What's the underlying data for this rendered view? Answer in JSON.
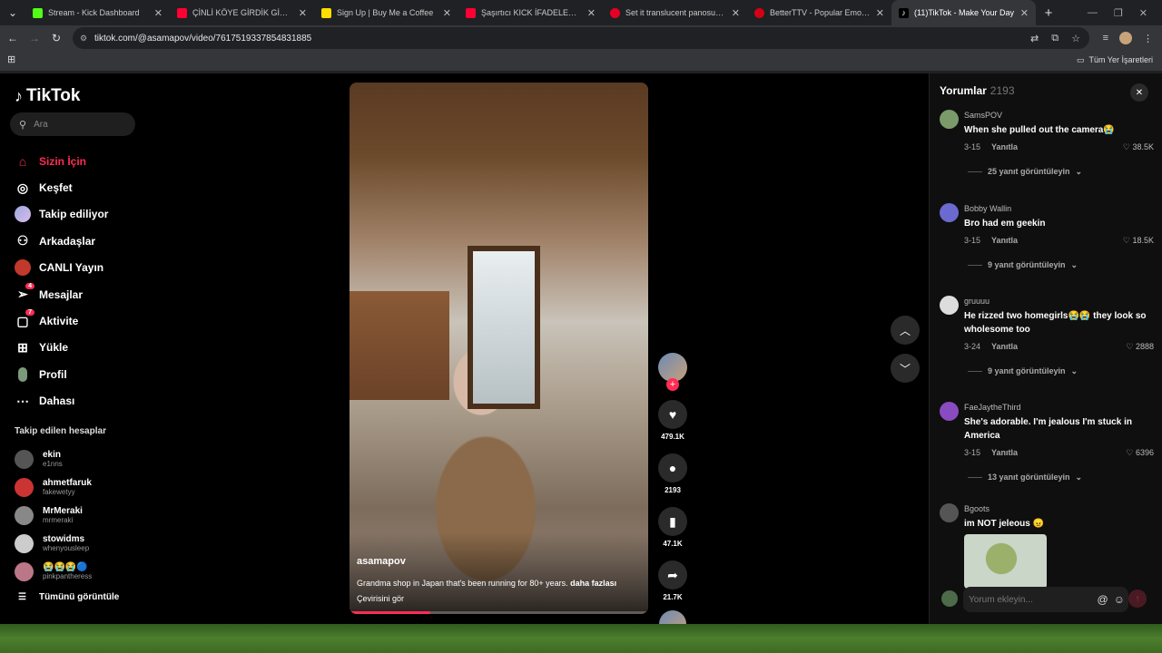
{
  "browser": {
    "tabs": [
      {
        "title": "Stream - Kick Dashboard",
        "color": "#53fc18"
      },
      {
        "title": "ÇİNLİ KÖYE GİRDİK GİRMEZ OL",
        "color": "#ff0033"
      },
      {
        "title": "Sign Up | Buy Me a Coffee",
        "color": "#ffdd00"
      },
      {
        "title": "Şaşırtıcı KICK İFADELERİ ve GİF",
        "color": "#ff0033"
      },
      {
        "title": "Set it translucent panosundaki",
        "color": "#e60023"
      },
      {
        "title": "BetterTTV - Popular Emotes",
        "color": "#d50014"
      },
      {
        "title": "(11)TikTok - Make Your Day",
        "color": "#ffffff"
      }
    ],
    "url": "tiktok.com/@asamapov/video/7617519337854831885",
    "bookmarks_all": "Tüm Yer İşaretleri"
  },
  "sidebar": {
    "logo": "TikTok",
    "search_placeholder": "Ara",
    "nav": [
      {
        "label": "Sizin İçin",
        "icon": "home-icon",
        "active": true
      },
      {
        "label": "Keşfet",
        "icon": "compass-icon"
      },
      {
        "label": "Takip ediliyor",
        "icon": "following-icon"
      },
      {
        "label": "Arkadaşlar",
        "icon": "friends-icon"
      },
      {
        "label": "CANLI Yayın",
        "icon": "live-icon"
      },
      {
        "label": "Mesajlar",
        "icon": "messages-icon",
        "badge": "4"
      },
      {
        "label": "Aktivite",
        "icon": "activity-icon",
        "badge": "7"
      },
      {
        "label": "Yükle",
        "icon": "upload-icon"
      },
      {
        "label": "Profil",
        "icon": "profile-icon"
      },
      {
        "label": "Dahası",
        "icon": "more-icon"
      }
    ],
    "following_title": "Takip edilen hesaplar",
    "following": [
      {
        "name": "ekin",
        "handle": "e1nns",
        "color": "#555"
      },
      {
        "name": "ahmetfaruk",
        "handle": "fakewetyy",
        "color": "#c33"
      },
      {
        "name": "MrMeraki",
        "handle": "mrmeraki",
        "color": "#888"
      },
      {
        "name": "stowidms",
        "handle": "whenyousleep",
        "color": "#ccc"
      },
      {
        "name": "😭😭😭🔵",
        "handle": "pinkpantheress",
        "color": "#b78"
      }
    ],
    "see_all": "Tümünü görüntüle"
  },
  "video": {
    "author": "asamapov",
    "description": "Grandma shop in Japan that's been running for 80+ years.",
    "more": "daha fazlası",
    "translation": "Çevirisini gör",
    "progress": 0.27
  },
  "actions": {
    "likes": "479.1K",
    "comments": "2193",
    "saves": "47.1K",
    "shares": "21.7K"
  },
  "comments": {
    "title": "Yorumlar",
    "count": "2193",
    "input_placeholder": "Yorum ekleyin...",
    "items": [
      {
        "user": "SamsPOV",
        "text": "When she pulled out the camera😭",
        "date": "3-15",
        "reply": "Yanıtla",
        "likes": "38.5K",
        "more": "25 yanıt görüntüleyin",
        "color": "#7a9a6a"
      },
      {
        "user": "Bobby Wallin",
        "text": "Bro had em geekin",
        "date": "3-15",
        "reply": "Yanıtla",
        "likes": "18.5K",
        "more": "9 yanıt görüntüleyin",
        "color": "#6a6ad0"
      },
      {
        "user": "gruuuu",
        "text": "He rizzed two homegirls😭😭 they look so wholesome too",
        "date": "3-24",
        "reply": "Yanıtla",
        "likes": "2888",
        "more": "9 yanıt görüntüleyin",
        "color": "#ddd"
      },
      {
        "user": "FaeJaytheThird",
        "text": "She's adorable. I'm jealous I'm stuck in America",
        "date": "3-15",
        "reply": "Yanıtla",
        "likes": "6396",
        "more": "13 yanıt görüntüleyin",
        "color": "#8a4ac0"
      },
      {
        "user": "Bgoots",
        "text": "im NOT jeleous 😠",
        "color": "#555"
      }
    ]
  }
}
